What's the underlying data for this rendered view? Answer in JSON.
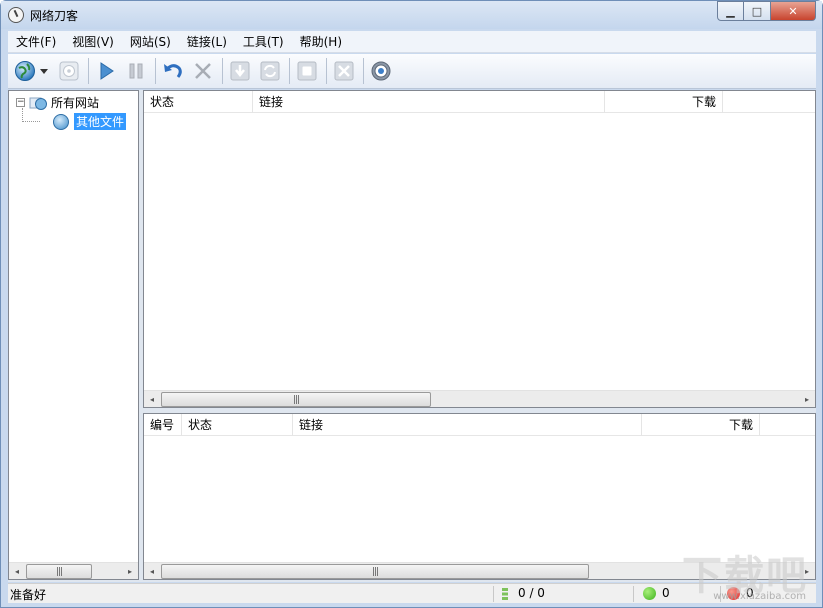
{
  "window": {
    "title": "网络刀客",
    "minimize_glyph": "▁",
    "maximize_glyph": "□",
    "close_glyph": "✕"
  },
  "menu": {
    "items": [
      {
        "label": "文件(F)"
      },
      {
        "label": "视图(V)"
      },
      {
        "label": "网站(S)"
      },
      {
        "label": "链接(L)"
      },
      {
        "label": "工具(T)"
      },
      {
        "label": "帮助(H)"
      }
    ]
  },
  "toolbar": {
    "buttons": [
      {
        "icon": "globe-icon",
        "enabled": true
      },
      {
        "icon": "dropdown-arrow-icon",
        "enabled": true
      },
      {
        "icon": "disc-icon",
        "enabled": false
      },
      {
        "icon": "play-icon",
        "enabled": true
      },
      {
        "icon": "pause-icon",
        "enabled": false
      },
      {
        "icon": "undo-icon",
        "enabled": true
      },
      {
        "icon": "delete-icon",
        "enabled": false
      },
      {
        "icon": "download-icon",
        "enabled": false
      },
      {
        "icon": "refresh-icon",
        "enabled": false
      },
      {
        "icon": "stop-icon",
        "enabled": false
      },
      {
        "icon": "close-box-icon",
        "enabled": false
      },
      {
        "icon": "settings-icon",
        "enabled": true
      }
    ]
  },
  "tree": {
    "root": {
      "label": "所有网站",
      "expander": "⊟"
    },
    "children": [
      {
        "label": "其他文件",
        "selected": true
      }
    ]
  },
  "top_pane": {
    "columns": [
      "状态",
      "链接",
      "下载"
    ]
  },
  "bottom_pane": {
    "columns": [
      "编号",
      "状态",
      "链接",
      "下载"
    ]
  },
  "scrollbar": {
    "left_arrow": "◂",
    "right_arrow": "▸",
    "grip": "|||"
  },
  "statusbar": {
    "text": "准备好",
    "progress": "0 / 0",
    "success_count": "0",
    "error_count": "0",
    "colors": {
      "success": "#3cb21c",
      "error": "#e02a2a"
    }
  },
  "watermark": {
    "text": "下载吧",
    "sub": "www.xiazaiba.com"
  }
}
